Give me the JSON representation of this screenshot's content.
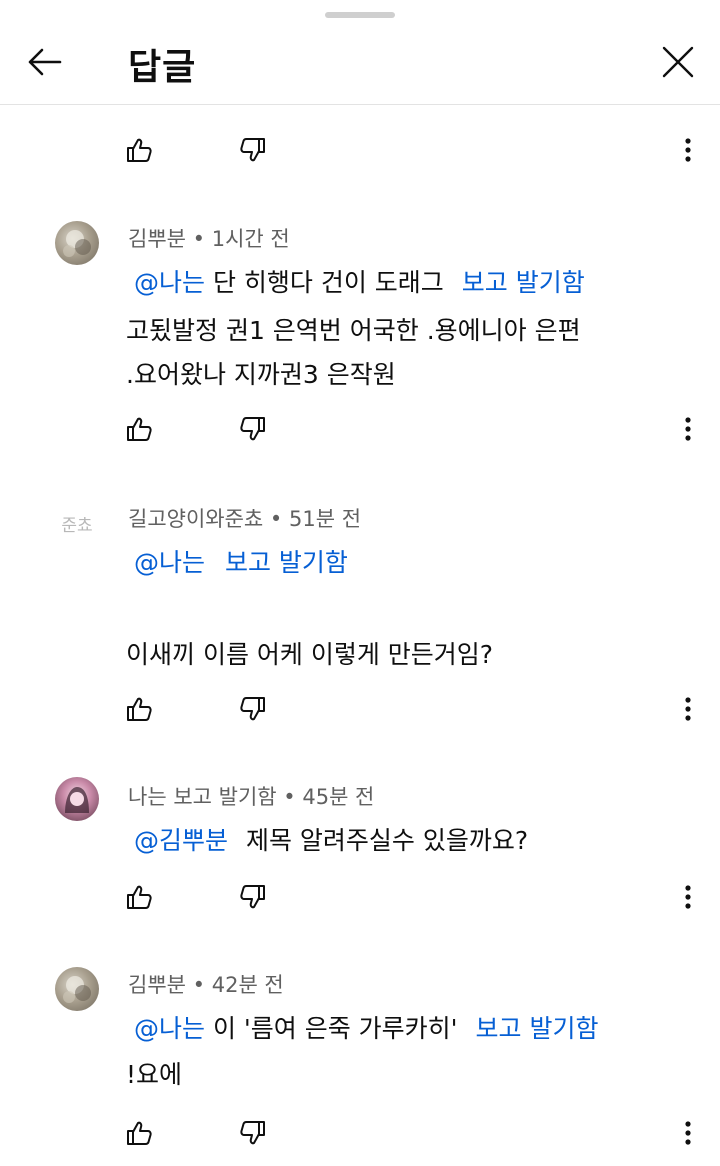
{
  "header": {
    "title": "답글"
  },
  "comments": [
    {
      "author": "김뿌분",
      "time": "1시간 전",
      "mention": "@나는",
      "line1_text": "단 히행다 건이 도래그",
      "line1_mention2": "보고 발기함",
      "line2": "고됬발정 권1 은역번 어국한 .용에니아 은편",
      "line3": ".요어왔나 지까권3 은작원"
    },
    {
      "author": "길고양이와준쵸",
      "time": "51분 전",
      "mention": "@나는",
      "mention2": "보고 발기함",
      "line2": "이새끼 이름 어케 이렇게 만든거임?",
      "avatar_text": "준쵸"
    },
    {
      "author": "나는 보고 발기함",
      "time": "45분 전",
      "mention": "@김뿌분",
      "line1_text": "제목 알려주실수 있을까요?"
    },
    {
      "author": "김뿌분",
      "time": "42분 전",
      "mention": "@나는",
      "line1_text": "이 '름여 은죽 가루카히'",
      "line1_mention2": "보고 발기함",
      "line2": "!요에"
    }
  ],
  "colors": {
    "link": "#065fd4",
    "meta": "#606060",
    "text": "#0f0f0f"
  }
}
